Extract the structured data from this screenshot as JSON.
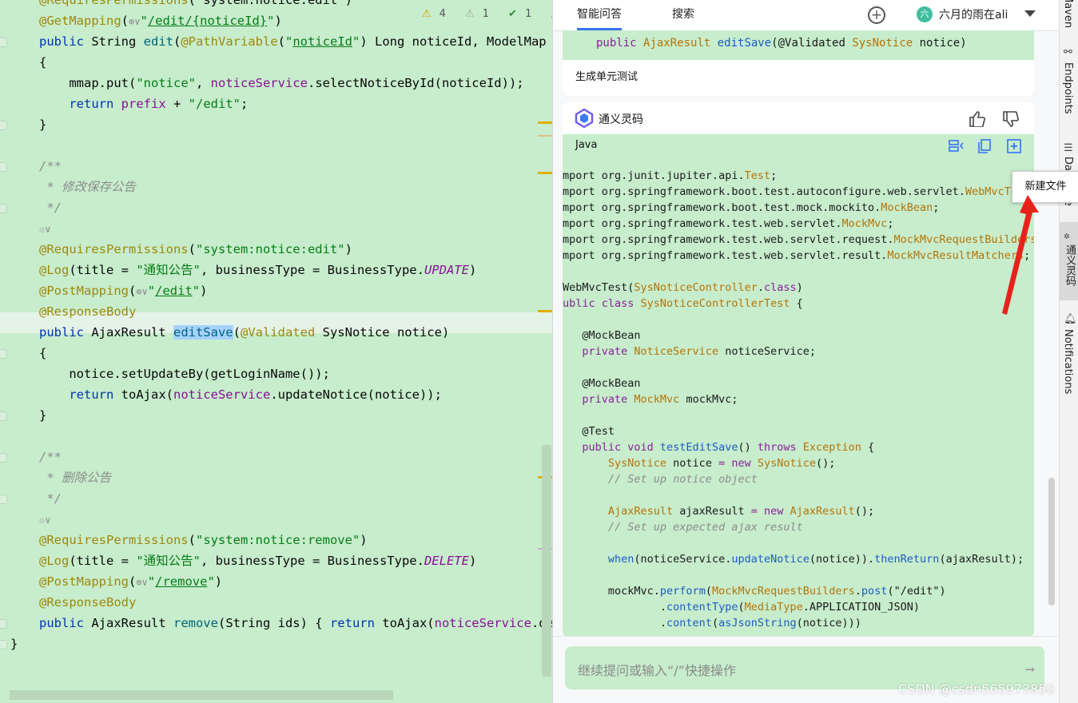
{
  "editor": {
    "inspections": {
      "warnings": "4",
      "weak_warnings": "1",
      "ok": "1"
    },
    "lines": [
      {
        "segs": [
          [
            "ann",
            "@RequiresPermissions"
          ],
          [
            "",
            "(\"system:notice:edit\")"
          ]
        ]
      },
      {
        "segs": [
          [
            "ann",
            "@GetMapping"
          ],
          [
            "",
            "("
          ],
          [
            "inlay",
            "⊕∨"
          ],
          [
            "str",
            "\""
          ],
          [
            "strlink",
            "/edit/{noticeId}"
          ],
          [
            "str",
            "\""
          ],
          [
            "",
            ")"
          ]
        ]
      },
      {
        "segs": [
          [
            "kw",
            "public "
          ],
          [
            "",
            "String "
          ],
          [
            "mth",
            "edit"
          ],
          [
            "",
            "("
          ],
          [
            "ann",
            "@PathVariable"
          ],
          [
            "",
            "("
          ],
          [
            "str",
            "\""
          ],
          [
            "strlink",
            "noticeId"
          ],
          [
            "str",
            "\""
          ],
          [
            "",
            ") Long noticeId, ModelMap mma"
          ]
        ]
      },
      {
        "segs": [
          [
            "",
            "{"
          ]
        ]
      },
      {
        "segs": [
          [
            "",
            "    mmap.put("
          ],
          [
            "str",
            "\"notice\""
          ],
          [
            "",
            ", "
          ],
          [
            "fld",
            "noticeService"
          ],
          [
            "",
            ".selectNoticeById(noticeId));"
          ]
        ]
      },
      {
        "segs": [
          [
            "kw",
            "    return "
          ],
          [
            "fld",
            "prefix"
          ],
          [
            "",
            " + "
          ],
          [
            "str",
            "\"/edit\""
          ],
          [
            "",
            ";"
          ]
        ]
      },
      {
        "segs": [
          [
            "",
            "}"
          ]
        ]
      },
      {
        "segs": [
          [
            "",
            ""
          ]
        ]
      },
      {
        "segs": [
          [
            "cmt",
            "/**"
          ]
        ]
      },
      {
        "segs": [
          [
            "cmt",
            " * 修改保存公告"
          ]
        ]
      },
      {
        "segs": [
          [
            "cmt",
            " */"
          ]
        ]
      },
      {
        "segs": [
          [
            "inlay",
            "♲∨"
          ]
        ]
      },
      {
        "segs": [
          [
            "ann",
            "@RequiresPermissions"
          ],
          [
            "",
            "("
          ],
          [
            "str",
            "\"system:notice:edit\""
          ],
          [
            "",
            ")"
          ]
        ]
      },
      {
        "segs": [
          [
            "ann",
            "@Log"
          ],
          [
            "",
            "(title = "
          ],
          [
            "str",
            "\"通知公告\""
          ],
          [
            "",
            ", businessType = BusinessType."
          ],
          [
            "fld it",
            "UPDATE"
          ],
          [
            "",
            ")"
          ]
        ]
      },
      {
        "segs": [
          [
            "ann",
            "@PostMapping"
          ],
          [
            "",
            "("
          ],
          [
            "inlay",
            "⊕∨"
          ],
          [
            "str",
            "\""
          ],
          [
            "strlink",
            "/edit"
          ],
          [
            "str",
            "\""
          ],
          [
            "",
            ")"
          ]
        ]
      },
      {
        "segs": [
          [
            "ann",
            "@ResponseBody"
          ]
        ]
      },
      {
        "segs": [
          [
            "kw",
            "public "
          ],
          [
            "",
            "AjaxResult "
          ],
          [
            "mth sel",
            "editSave"
          ],
          [
            "",
            "("
          ],
          [
            "ann",
            "@Validated "
          ],
          [
            "",
            "SysNotice notice)"
          ]
        ]
      },
      {
        "segs": [
          [
            "",
            "{"
          ]
        ]
      },
      {
        "segs": [
          [
            "",
            "    notice.setUpdateBy(getLoginName());"
          ]
        ]
      },
      {
        "segs": [
          [
            "kw",
            "    return "
          ],
          [
            "",
            "toAjax("
          ],
          [
            "fld",
            "noticeService"
          ],
          [
            "",
            ".updateNotice(notice));"
          ]
        ]
      },
      {
        "segs": [
          [
            "",
            "}"
          ]
        ]
      },
      {
        "segs": [
          [
            "",
            ""
          ]
        ]
      },
      {
        "segs": [
          [
            "cmt",
            "/**"
          ]
        ]
      },
      {
        "segs": [
          [
            "cmt",
            " * 删除公告"
          ]
        ]
      },
      {
        "segs": [
          [
            "cmt",
            " */"
          ]
        ]
      },
      {
        "segs": [
          [
            "inlay",
            "♲∨"
          ]
        ]
      },
      {
        "segs": [
          [
            "ann",
            "@RequiresPermissions"
          ],
          [
            "",
            "("
          ],
          [
            "str",
            "\"system:notice:remove\""
          ],
          [
            "",
            ")"
          ]
        ]
      },
      {
        "segs": [
          [
            "ann",
            "@Log"
          ],
          [
            "",
            "(title = "
          ],
          [
            "str",
            "\"通知公告\""
          ],
          [
            "",
            ", businessType = BusinessType."
          ],
          [
            "fld it",
            "DELETE"
          ],
          [
            "",
            ")"
          ]
        ]
      },
      {
        "segs": [
          [
            "ann",
            "@PostMapping"
          ],
          [
            "",
            "("
          ],
          [
            "inlay",
            "⊕∨"
          ],
          [
            "str",
            "\""
          ],
          [
            "strlink",
            "/remove"
          ],
          [
            "str",
            "\""
          ],
          [
            "",
            ")"
          ]
        ]
      },
      {
        "segs": [
          [
            "ann",
            "@ResponseBody"
          ]
        ]
      },
      {
        "segs": [
          [
            "kw",
            "public "
          ],
          [
            "",
            "AjaxResult "
          ],
          [
            "mth",
            "remove"
          ],
          [
            "",
            "(String ids) { "
          ],
          [
            "kw",
            "return "
          ],
          [
            "",
            "toAjax("
          ],
          [
            "fld",
            "noticeService"
          ],
          [
            "",
            ".delet"
          ]
        ]
      },
      {
        "segs": [
          [
            "",
            "}"
          ]
        ]
      }
    ]
  },
  "panel": {
    "tabs": [
      "智能问答",
      "搜索"
    ],
    "user_avatar": "六",
    "user_name": "六月的雨在ali",
    "prev_code": "public AjaxResult editSave(@Validated SysNotice notice)",
    "prev_message": "生成单元测试",
    "assistant_name": "通义灵码",
    "code_lang": "Java",
    "code_lines": [
      {
        "segs": [
          [
            "dk",
            "mport org.junit.jupiter.api."
          ],
          [
            "ty",
            "Test"
          ],
          [
            "dk",
            ";"
          ]
        ]
      },
      {
        "segs": [
          [
            "dk",
            "mport org.springframework.boot.test.autoconfigure.web.servlet."
          ],
          [
            "ty",
            "WebMvcTest"
          ],
          [
            "dk",
            ";"
          ]
        ]
      },
      {
        "segs": [
          [
            "dk",
            "mport org.springframework.boot.test.mock.mockito."
          ],
          [
            "ty",
            "MockBean"
          ],
          [
            "dk",
            ";"
          ]
        ]
      },
      {
        "segs": [
          [
            "dk",
            "mport org.springframework.test.web.servlet."
          ],
          [
            "ty",
            "MockMvc"
          ],
          [
            "dk",
            ";"
          ]
        ]
      },
      {
        "segs": [
          [
            "dk",
            "mport org.springframework.test.web.servlet.request."
          ],
          [
            "ty",
            "MockMvcRequestBuilders"
          ],
          [
            "dk",
            ";"
          ]
        ]
      },
      {
        "segs": [
          [
            "dk",
            "mport org.springframework.test.web.servlet.result."
          ],
          [
            "ty",
            "MockMvcResultMatchers"
          ],
          [
            "dk",
            ";"
          ]
        ]
      },
      {
        "segs": [
          [
            "dk",
            ""
          ]
        ]
      },
      {
        "segs": [
          [
            "dk",
            "WebMvcTest("
          ],
          [
            "ty",
            "SysNoticeController"
          ],
          [
            "dk",
            "."
          ],
          [
            "pu",
            "class"
          ],
          [
            "dk",
            ")"
          ]
        ]
      },
      {
        "segs": [
          [
            "pu",
            "ublic class "
          ],
          [
            "ty",
            "SysNoticeControllerTest"
          ],
          [
            "dk",
            " {"
          ]
        ]
      },
      {
        "segs": [
          [
            "dk",
            ""
          ]
        ]
      },
      {
        "segs": [
          [
            "dk",
            "   @MockBean"
          ]
        ]
      },
      {
        "segs": [
          [
            "pu",
            "   private "
          ],
          [
            "ty",
            "NoticeService"
          ],
          [
            "dk",
            " noticeService;"
          ]
        ]
      },
      {
        "segs": [
          [
            "dk",
            ""
          ]
        ]
      },
      {
        "segs": [
          [
            "dk",
            "   @MockBean"
          ]
        ]
      },
      {
        "segs": [
          [
            "pu",
            "   private "
          ],
          [
            "ty",
            "MockMvc"
          ],
          [
            "dk",
            " mockMvc;"
          ]
        ]
      },
      {
        "segs": [
          [
            "dk",
            ""
          ]
        ]
      },
      {
        "segs": [
          [
            "dk",
            "   @Test"
          ]
        ]
      },
      {
        "segs": [
          [
            "pu",
            "   public void "
          ],
          [
            "blue",
            "testEditSave"
          ],
          [
            "dk",
            "() "
          ],
          [
            "pu",
            "throws "
          ],
          [
            "ty",
            "Exception"
          ],
          [
            "dk",
            " {"
          ]
        ]
      },
      {
        "segs": [
          [
            "ty",
            "       SysNotice"
          ],
          [
            "dk",
            " notice "
          ],
          [
            "pu",
            "= new "
          ],
          [
            "ty",
            "SysNotice"
          ],
          [
            "dk",
            "();"
          ]
        ]
      },
      {
        "segs": [
          [
            "cm2",
            "       // Set up notice object"
          ]
        ]
      },
      {
        "segs": [
          [
            "dk",
            ""
          ]
        ]
      },
      {
        "segs": [
          [
            "ty",
            "       AjaxResult"
          ],
          [
            "dk",
            " ajaxResult "
          ],
          [
            "pu",
            "= new "
          ],
          [
            "ty",
            "AjaxResult"
          ],
          [
            "dk",
            "();"
          ]
        ]
      },
      {
        "segs": [
          [
            "cm2",
            "       // Set up expected ajax result"
          ]
        ]
      },
      {
        "segs": [
          [
            "dk",
            ""
          ]
        ]
      },
      {
        "segs": [
          [
            "blue",
            "       when"
          ],
          [
            "dk",
            "(noticeService."
          ],
          [
            "blue",
            "updateNotice"
          ],
          [
            "dk",
            "(notice))."
          ],
          [
            "blue",
            "thenReturn"
          ],
          [
            "dk",
            "(ajaxResult);"
          ]
        ]
      },
      {
        "segs": [
          [
            "dk",
            ""
          ]
        ]
      },
      {
        "segs": [
          [
            "dk",
            "       mockMvc."
          ],
          [
            "blue",
            "perform"
          ],
          [
            "dk",
            "("
          ],
          [
            "ty",
            "MockMvcRequestBuilders"
          ],
          [
            "dk",
            "."
          ],
          [
            "blue",
            "post"
          ],
          [
            "dk",
            "(\"/edit\")"
          ]
        ]
      },
      {
        "segs": [
          [
            "dk",
            "               ."
          ],
          [
            "blue",
            "contentType"
          ],
          [
            "dk",
            "("
          ],
          [
            "ty",
            "MediaType"
          ],
          [
            "dk",
            ".APPLICATION_JSON)"
          ]
        ]
      },
      {
        "segs": [
          [
            "dk",
            "               ."
          ],
          [
            "blue",
            "content"
          ],
          [
            "dk",
            "("
          ],
          [
            "blue",
            "asJsonString"
          ],
          [
            "dk",
            "(notice)))"
          ]
        ]
      }
    ],
    "input_placeholder": "继续提问或输入“/”快捷操作"
  },
  "strip": {
    "maven": "Maven",
    "endpoints": "Endpoints",
    "database": "Database",
    "lingma": "通义灵码",
    "notifications": "Notifications"
  },
  "tooltip": "新建文件",
  "watermark": "CSDN @csdn565973850"
}
